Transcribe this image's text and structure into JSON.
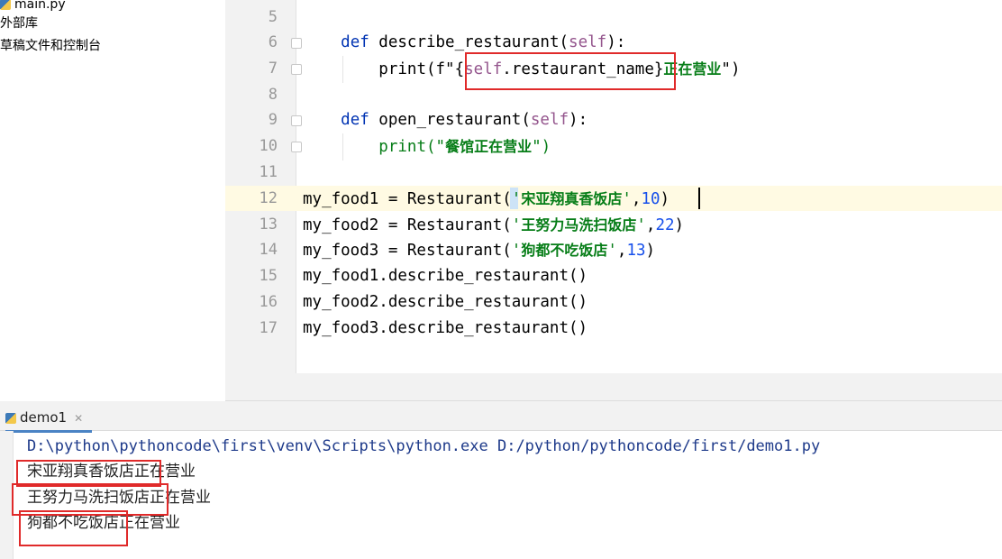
{
  "project_tree": {
    "items": [
      {
        "label": "main.py",
        "icon": "python-file-icon"
      },
      {
        "label": "外部库"
      },
      {
        "label": "草稿文件和控制台"
      }
    ]
  },
  "editor": {
    "line_numbers": [
      "5",
      "6",
      "7",
      "8",
      "9",
      "10",
      "11",
      "12",
      "13",
      "14",
      "15",
      "16",
      "17"
    ],
    "lines": {
      "l6": {
        "indent": "    ",
        "kw": "def",
        "name": " describe_restaurant(",
        "self": "self",
        "tail": "):"
      },
      "l7": {
        "indent": "        ",
        "pre": "print(f\"{",
        "self": "self",
        "attr": ".restaurant_name",
        "close": "}",
        "cn": "正在营业",
        "tail": "\")"
      },
      "l9": {
        "indent": "    ",
        "kw": "def",
        "name": " open_restaurant(",
        "self": "self",
        "tail": "):"
      },
      "l10": {
        "indent": "        ",
        "pre": "print(\"",
        "cn": "餐馆正在营业",
        "tail": "\")"
      },
      "l12": {
        "pre": "my_food1 = Restaurant(",
        "q1": "'",
        "cn": "宋亚翔真香饭店",
        "q2": "'",
        "comma": ",",
        "num": "10",
        "tail": ")"
      },
      "l13": {
        "pre": "my_food2 = Restaurant(",
        "q1": "'",
        "cn": "王努力马洗扫饭店",
        "q2": "'",
        "comma": ",",
        "num": "22",
        "tail": ")"
      },
      "l14": {
        "pre": "my_food3 = Restaurant(",
        "q1": "'",
        "cn": "狗都不吃饭店",
        "q2": "'",
        "comma": ",",
        "num": "13",
        "tail": ")"
      },
      "l15": {
        "text": "my_food1.describe_restaurant()"
      },
      "l16": {
        "text": "my_food2.describe_restaurant()"
      },
      "l17": {
        "text": "my_food3.describe_restaurant()"
      }
    }
  },
  "run_panel": {
    "tab_label": "demo1",
    "tab_icon": "python-run-icon",
    "command": "D:\\python\\pythoncode\\first\\venv\\Scripts\\python.exe D:/python/pythoncode/first/demo1.py",
    "output": [
      "宋亚翔真香饭店正在营业",
      "王努力马洗扫饭店正在营业",
      "狗都不吃饭店正在营业"
    ]
  },
  "colors": {
    "keyword": "#0033b3",
    "self": "#94558d",
    "string": "#067d17",
    "number": "#1750eb",
    "highlight_box": "#e02a2a",
    "current_line": "#fffae3"
  }
}
